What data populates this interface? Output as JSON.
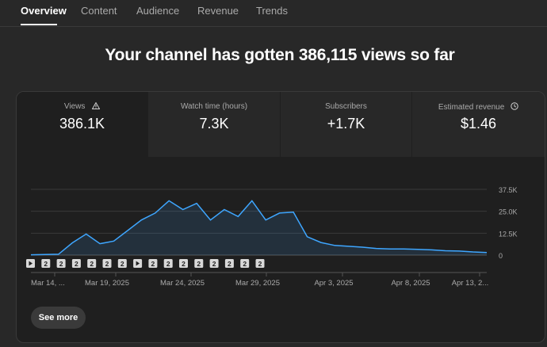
{
  "tabs": [
    {
      "label": "Overview",
      "active": true
    },
    {
      "label": "Content"
    },
    {
      "label": "Audience"
    },
    {
      "label": "Revenue"
    },
    {
      "label": "Trends"
    }
  ],
  "headline": "Your channel has gotten 386,115 views so far",
  "metrics": [
    {
      "label": "Views",
      "value": "386.1K",
      "icon": "warning-icon",
      "active": true
    },
    {
      "label": "Watch time (hours)",
      "value": "7.3K"
    },
    {
      "label": "Subscribers",
      "value": "+1.7K"
    },
    {
      "label": "Estimated revenue",
      "value": "$1.46",
      "icon": "clock-icon"
    }
  ],
  "markers": [
    "play",
    "2",
    "2",
    "2",
    "2",
    "2",
    "2",
    "play",
    "2",
    "2",
    "2",
    "2",
    "2",
    "2",
    "2",
    "2"
  ],
  "see_more_label": "See more",
  "colors": {
    "line": "#3ea6ff",
    "background": "#282828",
    "card": "#1f1f1f"
  },
  "chart_data": {
    "type": "area",
    "x_tick_labels": [
      "Mar 14, ...",
      "Mar 19, 2025",
      "Mar 24, 2025",
      "Mar 29, 2025",
      "Apr 3, 2025",
      "Apr 8, 2025",
      "Apr 13, 2..."
    ],
    "y_tick_labels": [
      "37.5K",
      "25.0K",
      "12.5K",
      "0"
    ],
    "ylim": [
      0,
      37500
    ],
    "grid": true,
    "x": [
      "Mar 14",
      "Mar 15",
      "Mar 16",
      "Mar 17",
      "Mar 18",
      "Mar 19",
      "Mar 20",
      "Mar 21",
      "Mar 22",
      "Mar 23",
      "Mar 24",
      "Mar 25",
      "Mar 26",
      "Mar 27",
      "Mar 28",
      "Mar 29",
      "Mar 30",
      "Mar 31",
      "Apr 1",
      "Apr 2",
      "Apr 3",
      "Apr 4",
      "Apr 5",
      "Apr 6",
      "Apr 7",
      "Apr 8",
      "Apr 9",
      "Apr 10",
      "Apr 11",
      "Apr 12",
      "Apr 13",
      "Apr 14",
      "Apr 15",
      "Apr 16"
    ],
    "values": [
      200,
      300,
      500,
      7000,
      12000,
      6500,
      8000,
      14000,
      20000,
      24000,
      31000,
      26000,
      29500,
      20000,
      26000,
      22000,
      31000,
      20000,
      24000,
      24500,
      10500,
      7200,
      5500,
      5000,
      4500,
      3800,
      3500,
      3500,
      3300,
      3000,
      2500,
      2300,
      1800,
      1500
    ]
  }
}
